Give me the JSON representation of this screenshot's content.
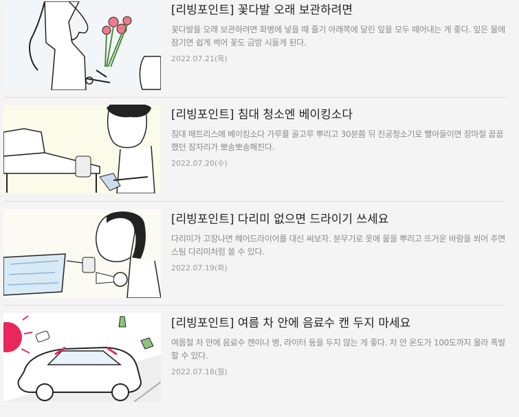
{
  "articles": [
    {
      "title": "[리빙포인트] 꽃다발 오래 보관하려면",
      "summary": "꽃다발을 오래 보관하려면 화병에 넣을 때 줄기 아래쪽에 달린 잎을 모두 떼어내는 게 좋다. 잎은 물에 잠기면 쉽게 썩어 꽃도 금방 시들게 된다.",
      "date": "2022.07.21(목)",
      "thumb_bg": "#f3f6f8"
    },
    {
      "title": "[리빙포인트] 침대 청소엔 베이킹소다",
      "summary": "침대 매트리스에 베이킹소다 가루를 골고루 뿌리고 30분쯤 뒤 진공청소기로 빨아들이면 장마철 꿉꿉했던 잠자리가 뽀송뽀송해진다.",
      "date": "2022.07.20(수)",
      "thumb_bg": "#fbfbe9"
    },
    {
      "title": "[리빙포인트] 다리미 없으면 드라이기 쓰세요",
      "summary": "다리미가 고장나면 헤어드라이어를 대신 써보자. 분무기로 옷에 물을 뿌리고 뜨거운 바람을 쐬어 주면 스팀 다리미처럼 쓸 수 있다.",
      "date": "2022.07.19(화)",
      "thumb_bg": "#fbfbf4"
    },
    {
      "title": "[리빙포인트] 여름 차 안에 음료수 캔 두지 마세요",
      "summary": "여름철 차 안에 음료수 캔이나 병, 라이터 등을 두지 않는 게 좋다. 차 안 온도가 100도까지 올라 폭발할 수 있다.",
      "date": "2022.07.18(월)",
      "thumb_bg": "#ffffff"
    }
  ]
}
